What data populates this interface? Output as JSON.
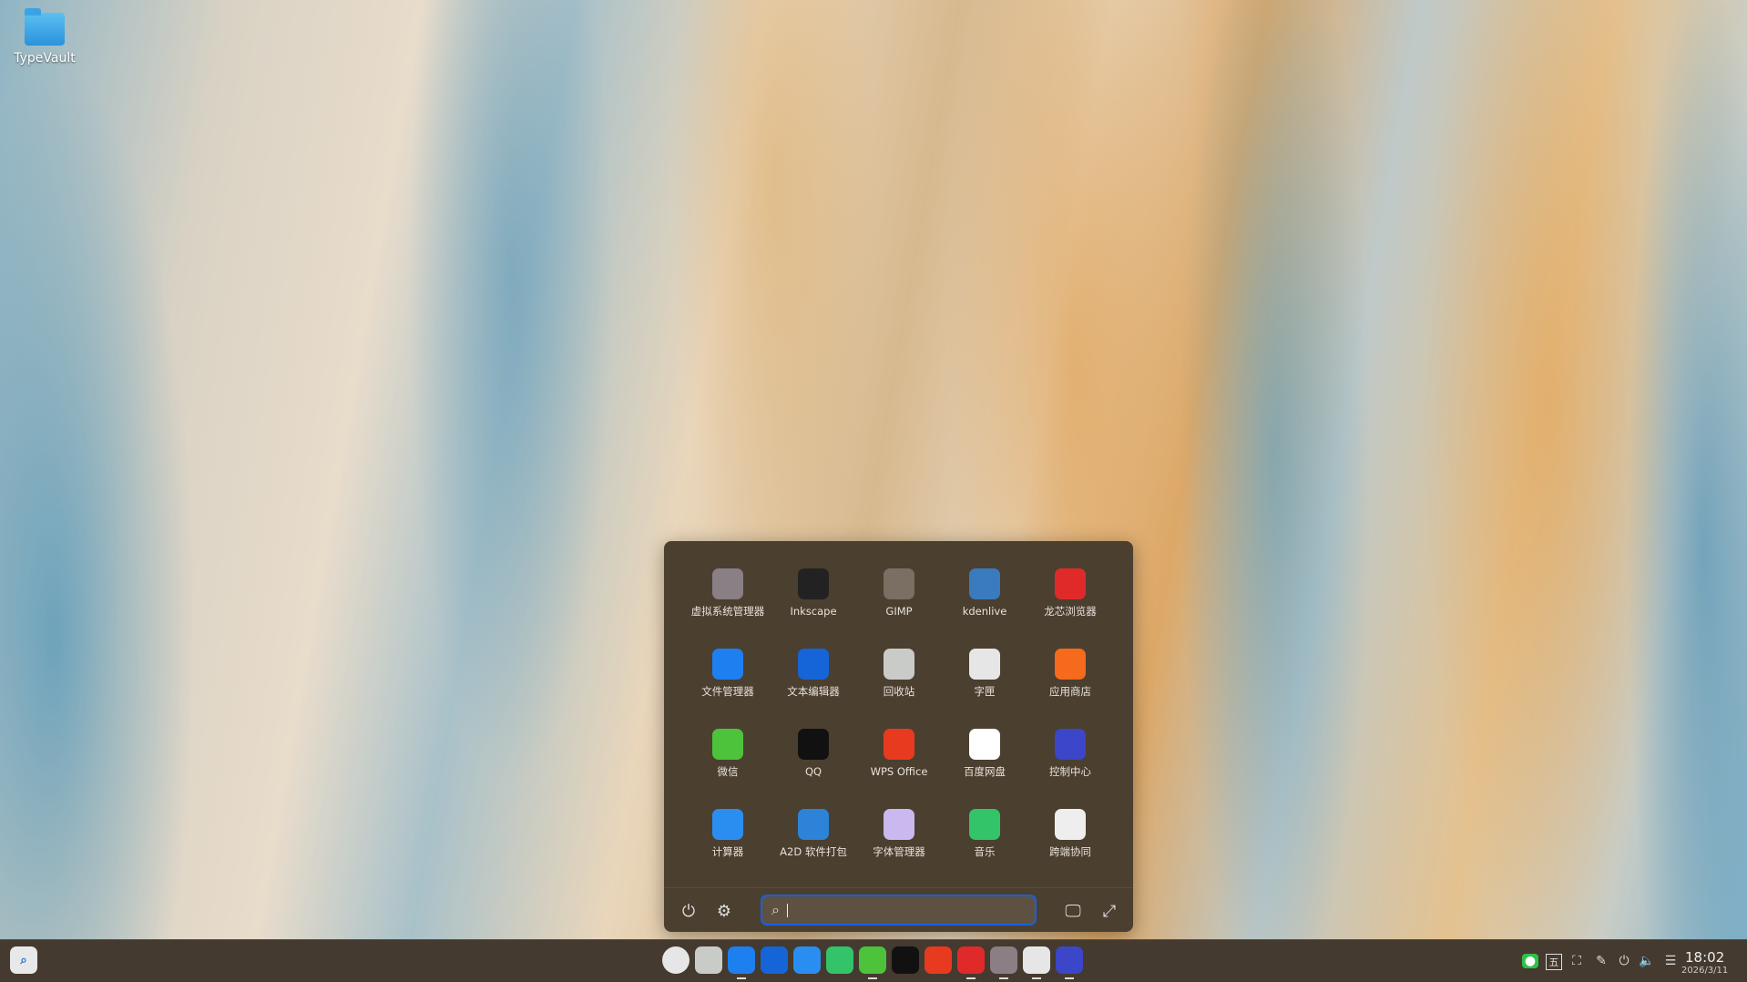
{
  "desktop": {
    "icons": [
      {
        "label": "TypeVault",
        "icon": "folder-icon"
      }
    ]
  },
  "launcher": {
    "apps": [
      {
        "label": "虚拟系统管理器",
        "icon": "vmm-icon",
        "color": "#8a7f85"
      },
      {
        "label": "Inkscape",
        "icon": "inkscape-icon",
        "color": "#222222"
      },
      {
        "label": "GIMP",
        "icon": "gimp-icon",
        "color": "#7a6f62"
      },
      {
        "label": "kdenlive",
        "icon": "kdenlive-icon",
        "color": "#3a7bbf"
      },
      {
        "label": "龙芯浏览器",
        "icon": "loongson-browser-icon",
        "color": "#e02a2a"
      },
      {
        "label": "文件管理器",
        "icon": "file-manager-icon",
        "color": "#1e7ff0"
      },
      {
        "label": "文本编辑器",
        "icon": "text-editor-icon",
        "color": "#1565d8"
      },
      {
        "label": "回收站",
        "icon": "trash-icon",
        "color": "#c9cbc9"
      },
      {
        "label": "字匣",
        "icon": "zigui-icon",
        "color": "#e6e6e6"
      },
      {
        "label": "应用商店",
        "icon": "app-store-icon",
        "color": "#f56a1c"
      },
      {
        "label": "微信",
        "icon": "wechat-icon",
        "color": "#4cc33a"
      },
      {
        "label": "QQ",
        "icon": "qq-icon",
        "color": "#111111"
      },
      {
        "label": "WPS Office",
        "icon": "wps-icon",
        "color": "#e83a1e"
      },
      {
        "label": "百度网盘",
        "icon": "baidu-netdisk-icon",
        "color": "#ffffff"
      },
      {
        "label": "控制中心",
        "icon": "control-center-icon",
        "color": "#3b46c9"
      },
      {
        "label": "计算器",
        "icon": "calculator-icon",
        "color": "#2a8ef0"
      },
      {
        "label": "A2D 软件打包",
        "icon": "a2d-packager-icon",
        "color": "#2c83d8"
      },
      {
        "label": "字体管理器",
        "icon": "font-manager-icon",
        "color": "#c9b9ee"
      },
      {
        "label": "音乐",
        "icon": "music-icon",
        "color": "#33c46a"
      },
      {
        "label": "跨端协同",
        "icon": "cross-device-icon",
        "color": "#eeeeee"
      }
    ],
    "search": {
      "placeholder": "",
      "value": ""
    }
  },
  "taskbar": {
    "apps": [
      {
        "icon": "launcher-icon",
        "running": false,
        "color": "#e6e6e6"
      },
      {
        "icon": "trash-icon",
        "running": false,
        "color": "#c9cbc9"
      },
      {
        "icon": "file-manager-icon",
        "running": true,
        "color": "#1e7ff0"
      },
      {
        "icon": "text-editor-icon",
        "running": false,
        "color": "#1565d8"
      },
      {
        "icon": "calculator-icon",
        "running": false,
        "color": "#2a8ef0"
      },
      {
        "icon": "music-icon",
        "running": false,
        "color": "#33c46a"
      },
      {
        "icon": "wechat-icon",
        "running": true,
        "color": "#4cc33a"
      },
      {
        "icon": "qq-icon",
        "running": false,
        "color": "#111111"
      },
      {
        "icon": "wps-icon",
        "running": false,
        "color": "#e83a1e"
      },
      {
        "icon": "loongson-browser-icon",
        "running": true,
        "color": "#e02a2a"
      },
      {
        "icon": "vmm-icon",
        "running": true,
        "color": "#8a7f85"
      },
      {
        "icon": "zigui-icon",
        "running": true,
        "color": "#e6e6e6"
      },
      {
        "icon": "control-center-icon",
        "running": true,
        "color": "#3b46c9"
      }
    ],
    "tray": {
      "ime": "五"
    },
    "time": "18:02",
    "date": "2026/3/11"
  }
}
